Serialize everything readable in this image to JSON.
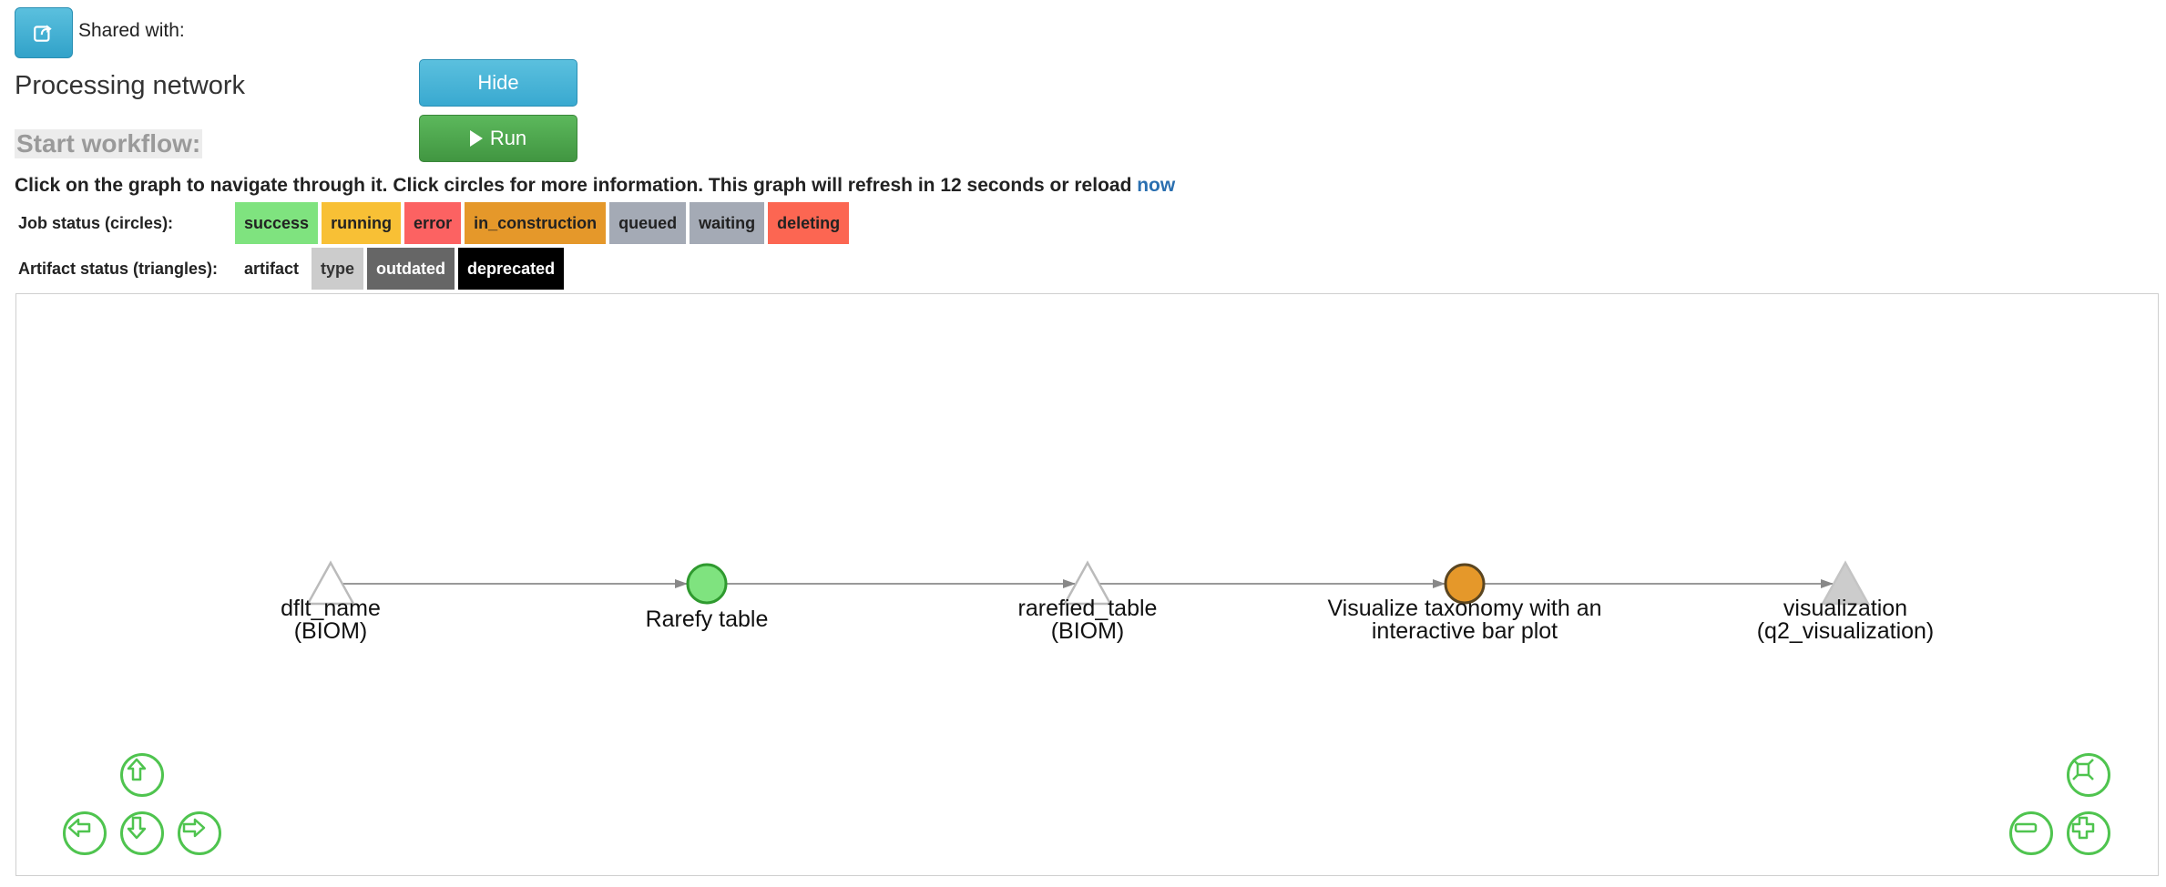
{
  "header": {
    "shared_label": "Shared with:",
    "page_title": "Processing network",
    "hide_label": "Hide",
    "start_label": "Start workflow:",
    "run_label": "Run"
  },
  "instructions": {
    "text": "Click on the graph to navigate through it. Click circles for more information. This graph will refresh in 12 seconds or reload ",
    "link": "now"
  },
  "job_legend": {
    "title": "Job status (circles):",
    "items": [
      {
        "label": "success",
        "color": "#7fe37f"
      },
      {
        "label": "running",
        "color": "#f8c035"
      },
      {
        "label": "error",
        "color": "#fc6262"
      },
      {
        "label": "in_construction",
        "color": "#e5982a"
      },
      {
        "label": "queued",
        "color": "#a4aab5"
      },
      {
        "label": "waiting",
        "color": "#a4aab5"
      },
      {
        "label": "deleting",
        "color": "#fc6652"
      }
    ]
  },
  "artifact_legend": {
    "title": "Artifact status (triangles):",
    "items": [
      {
        "label": "artifact",
        "color": "#ffffff",
        "text_color": "#222222"
      },
      {
        "label": "type",
        "color": "#cccccc",
        "text_color": "#333333"
      },
      {
        "label": "outdated",
        "color": "#666666",
        "text_color": "#ffffff"
      },
      {
        "label": "deprecated",
        "color": "#000000",
        "text_color": "#ffffff"
      }
    ]
  },
  "graph": {
    "nodes": [
      {
        "shape": "triangle",
        "status": "artifact",
        "color": "#ffffff",
        "label_lines": [
          "dflt_name",
          "(BIOM)"
        ]
      },
      {
        "shape": "circle",
        "status": "success",
        "color": "#7fe37f",
        "label_lines": [
          "Rarefy table"
        ]
      },
      {
        "shape": "triangle",
        "status": "artifact",
        "color": "#ffffff",
        "label_lines": [
          "rarefied_table",
          "(BIOM)"
        ]
      },
      {
        "shape": "circle",
        "status": "in_construction",
        "color": "#e5982a",
        "label_lines": [
          "Visualize taxonomy with an",
          "interactive bar plot"
        ]
      },
      {
        "shape": "triangle",
        "status": "type",
        "color": "#cccccc",
        "label_lines": [
          "visualization",
          "(q2_visualization)"
        ]
      }
    ],
    "edges": [
      {
        "from": 0,
        "to": 1
      },
      {
        "from": 1,
        "to": 2
      },
      {
        "from": 2,
        "to": 3
      },
      {
        "from": 3,
        "to": 4
      }
    ]
  },
  "navigation": {
    "buttons": [
      "up",
      "left",
      "down",
      "right",
      "fit",
      "zoom-out",
      "zoom-in"
    ],
    "accent": "#4fc44f"
  }
}
